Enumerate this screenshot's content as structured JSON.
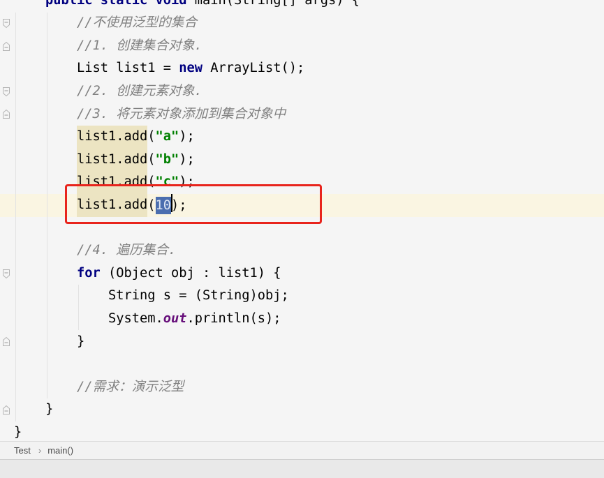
{
  "editor": {
    "lines": [
      {
        "tokens": [
          "public static void",
          " main(String[] args) {"
        ]
      },
      {
        "tokens": [
          "//不使用泛型的集合"
        ]
      },
      {
        "tokens": [
          "//1. 创建集合对象."
        ]
      },
      {
        "tokens": [
          "List list1 = ",
          "new",
          " ArrayList();"
        ]
      },
      {
        "tokens": [
          "//2. 创建元素对象."
        ]
      },
      {
        "tokens": [
          "//3. 将元素对象添加到集合对象中"
        ]
      },
      {
        "tokens": [
          "list1.add",
          "(",
          "\"a\"",
          ");"
        ]
      },
      {
        "tokens": [
          "list1.add",
          "(",
          "\"b\"",
          ");"
        ]
      },
      {
        "tokens": [
          "list1.add",
          "(",
          "\"c\"",
          ");"
        ]
      },
      {
        "tokens": [
          "list1.add",
          "(",
          "10",
          ");"
        ]
      },
      {
        "tokens": []
      },
      {
        "tokens": [
          "//4. 遍历集合."
        ]
      },
      {
        "tokens": [
          "for",
          " (Object obj : list1) {"
        ]
      },
      {
        "tokens": [
          "String s = (String)obj;"
        ]
      },
      {
        "tokens": [
          "System.",
          "out",
          ".println(s);"
        ]
      },
      {
        "tokens": [
          "}"
        ]
      },
      {
        "tokens": []
      },
      {
        "tokens": [
          "//需求：演示泛型"
        ]
      },
      {
        "tokens": [
          "}"
        ]
      },
      {
        "tokens": [
          "}"
        ]
      }
    ]
  },
  "breadcrumb": {
    "items": [
      "Test",
      "main()"
    ],
    "separator": "›"
  },
  "icons": {
    "fold_start": "fold-start-icon",
    "fold_end": "fold-end-icon"
  },
  "colors": {
    "editor_background": "#f5f5f5",
    "keyword": "#000080",
    "comment": "#808080",
    "string": "#008000",
    "static_field": "#660e7a",
    "selection": "#4b6eaf",
    "usage_highlight": "#ece4c2",
    "caret_row": "#faf5e2",
    "annotation_box": "#e8241c"
  }
}
